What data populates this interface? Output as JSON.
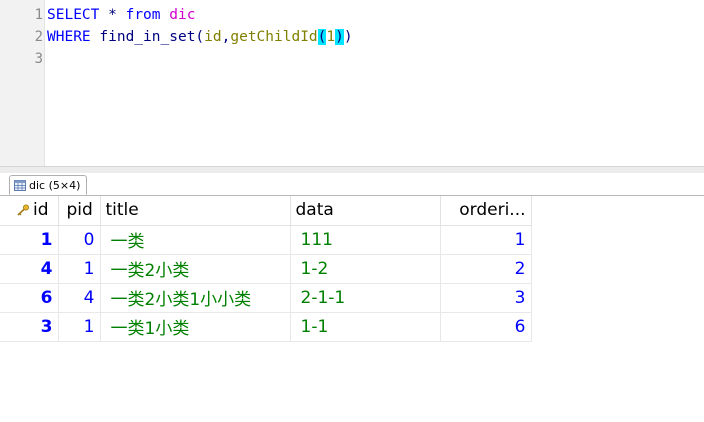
{
  "editor": {
    "line_numbers": [
      "1",
      "2",
      "3"
    ],
    "line1": {
      "kw_select": "SELECT",
      "star": "*",
      "kw_from": "from",
      "table": "dic"
    },
    "line2": {
      "kw_where": "WHERE",
      "fn": "find_in_set",
      "lp": "(",
      "arg_id": "id",
      "comma": ",",
      "fn2": "getChildId",
      "lp2": "(",
      "num": "1",
      "rp2": ")",
      "rp": ")"
    }
  },
  "result_tab": {
    "label": "dic (5×4)"
  },
  "grid": {
    "columns": [
      "id",
      "pid",
      "title",
      "data",
      "orderi..."
    ],
    "rows": [
      {
        "id": "1",
        "pid": "0",
        "title": "一类",
        "data": "111",
        "ordering": "1"
      },
      {
        "id": "4",
        "pid": "1",
        "title": "一类2小类",
        "data": "1-2",
        "ordering": "2"
      },
      {
        "id": "6",
        "pid": "4",
        "title": "一类2小类1小小类",
        "data": "2-1-1",
        "ordering": "3"
      },
      {
        "id": "3",
        "pid": "1",
        "title": "一类1小类",
        "data": "1-1",
        "ordering": "6"
      }
    ]
  },
  "colors": {
    "keyword": "#0000ff",
    "table_name": "#d100d1",
    "function": "#808000",
    "bracket_highlight": "#00e5ff",
    "numeric_value": "#0000ff",
    "text_value": "#008000"
  }
}
